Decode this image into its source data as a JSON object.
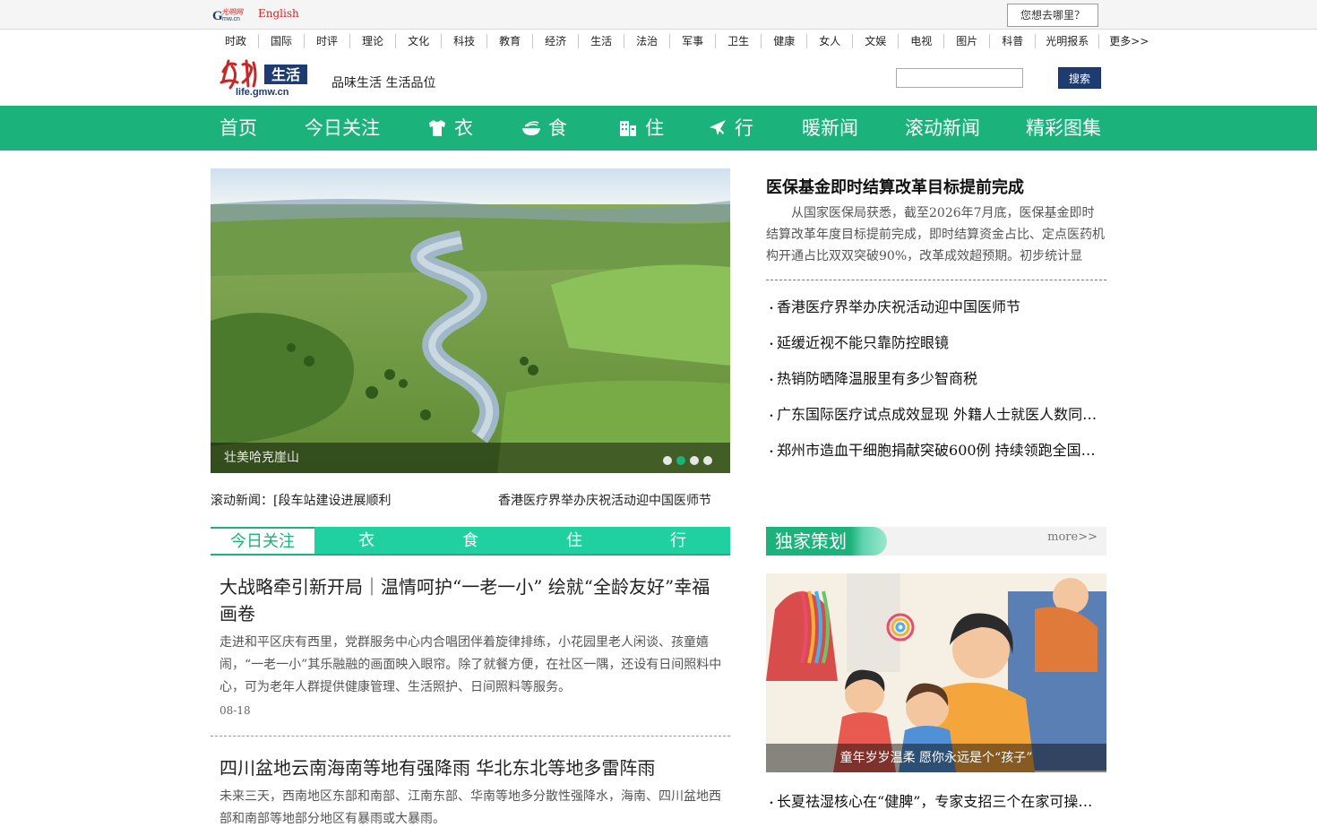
{
  "topbar": {
    "english": "English",
    "where_button": "您想去哪里？"
  },
  "channels": [
    "时政",
    "国际",
    "时评",
    "理论",
    "文化",
    "科技",
    "教育",
    "经济",
    "生活",
    "法治",
    "军事",
    "卫生",
    "健康",
    "女人",
    "文娱",
    "电视",
    "图片",
    "科普",
    "光明报系",
    "更多>>"
  ],
  "header": {
    "brand_text": "生活",
    "brand_url_text": "life.gmw.cn",
    "slogan": "品味生活 生活品位",
    "search_button": "搜索",
    "search_value": ""
  },
  "mainnav": [
    {
      "label": "首页",
      "icon": ""
    },
    {
      "label": "今日关注",
      "icon": ""
    },
    {
      "label": "衣",
      "icon": "shirt-icon"
    },
    {
      "label": "食",
      "icon": "food-bowl-icon"
    },
    {
      "label": "住",
      "icon": "building-icon"
    },
    {
      "label": "行",
      "icon": "airplane-icon"
    },
    {
      "label": "暖新闻",
      "icon": ""
    },
    {
      "label": "滚动新闻",
      "icon": ""
    },
    {
      "label": "精彩图集",
      "icon": ""
    }
  ],
  "slideshow": {
    "caption": "壮美哈克崖山",
    "dot_count": 4,
    "active_dot": 1
  },
  "scrolling": {
    "label": "滚动新闻：",
    "item1": "[段车站建设进展顺利",
    "item2": "香港医疗界举办庆祝活动迎中国医师节"
  },
  "headline": {
    "title": "医保基金即时结算改革目标提前完成",
    "summary": "从国家医保局获悉，截至2026年7月底，医保基金即时结算改革年度目标提前完成，即时结算资金占比、定点医药机构开通占比双双突破90%，改革成效超预期。初步统计显示，…"
  },
  "news_list": [
    "香港医疗界举办庆祝活动迎中国医师节",
    "延缓近视不能只靠防控眼镜",
    "热销防晒降温服里有多少智商税",
    "广东国际医疗试点成效显现 外籍人士就医人数同比…",
    "郑州市造血干细胞捐献突破600例 持续领跑全国省…"
  ],
  "tabs": [
    "今日关注",
    "衣",
    "食",
    "住",
    "行"
  ],
  "stories": [
    {
      "title": "大战略牵引新开局｜温情呵护“一老一小” 绘就“全龄友好”幸福画卷",
      "text": "走进和平区庆有西里，党群服务中心内合唱团伴着旋律排练，小花园里老人闲谈、孩童嬉闹，“一老一小”其乐融融的画面映入眼帘。除了就餐方便，在社区一隅，还设有日间照料中心，可为老年人群提供健康管理、生活照护、日间照料等服务。",
      "date": "08-18"
    },
    {
      "title": "四川盆地云南海南等地有强降雨 华北东北等地多雷阵雨",
      "text": "未来三天，西南地区东部和南部、江南东部、华南等地多分散性强降水，海南、四川盆地西部和南部等地部分地区有暴雨或大暴雨。",
      "date": ""
    }
  ],
  "exclusive": {
    "title": "独家策划",
    "more": "more>>",
    "image_caption": "童年岁岁温柔 愿你永远是个“孩子”",
    "item": "长夏祛湿核心在“健脾”，专家支招三个在家可操作…"
  },
  "colors": {
    "brand_green": "#1cb27c",
    "tab_green": "#21d0a0",
    "search_blue": "#1e3c72",
    "english_red": "#c62828"
  }
}
